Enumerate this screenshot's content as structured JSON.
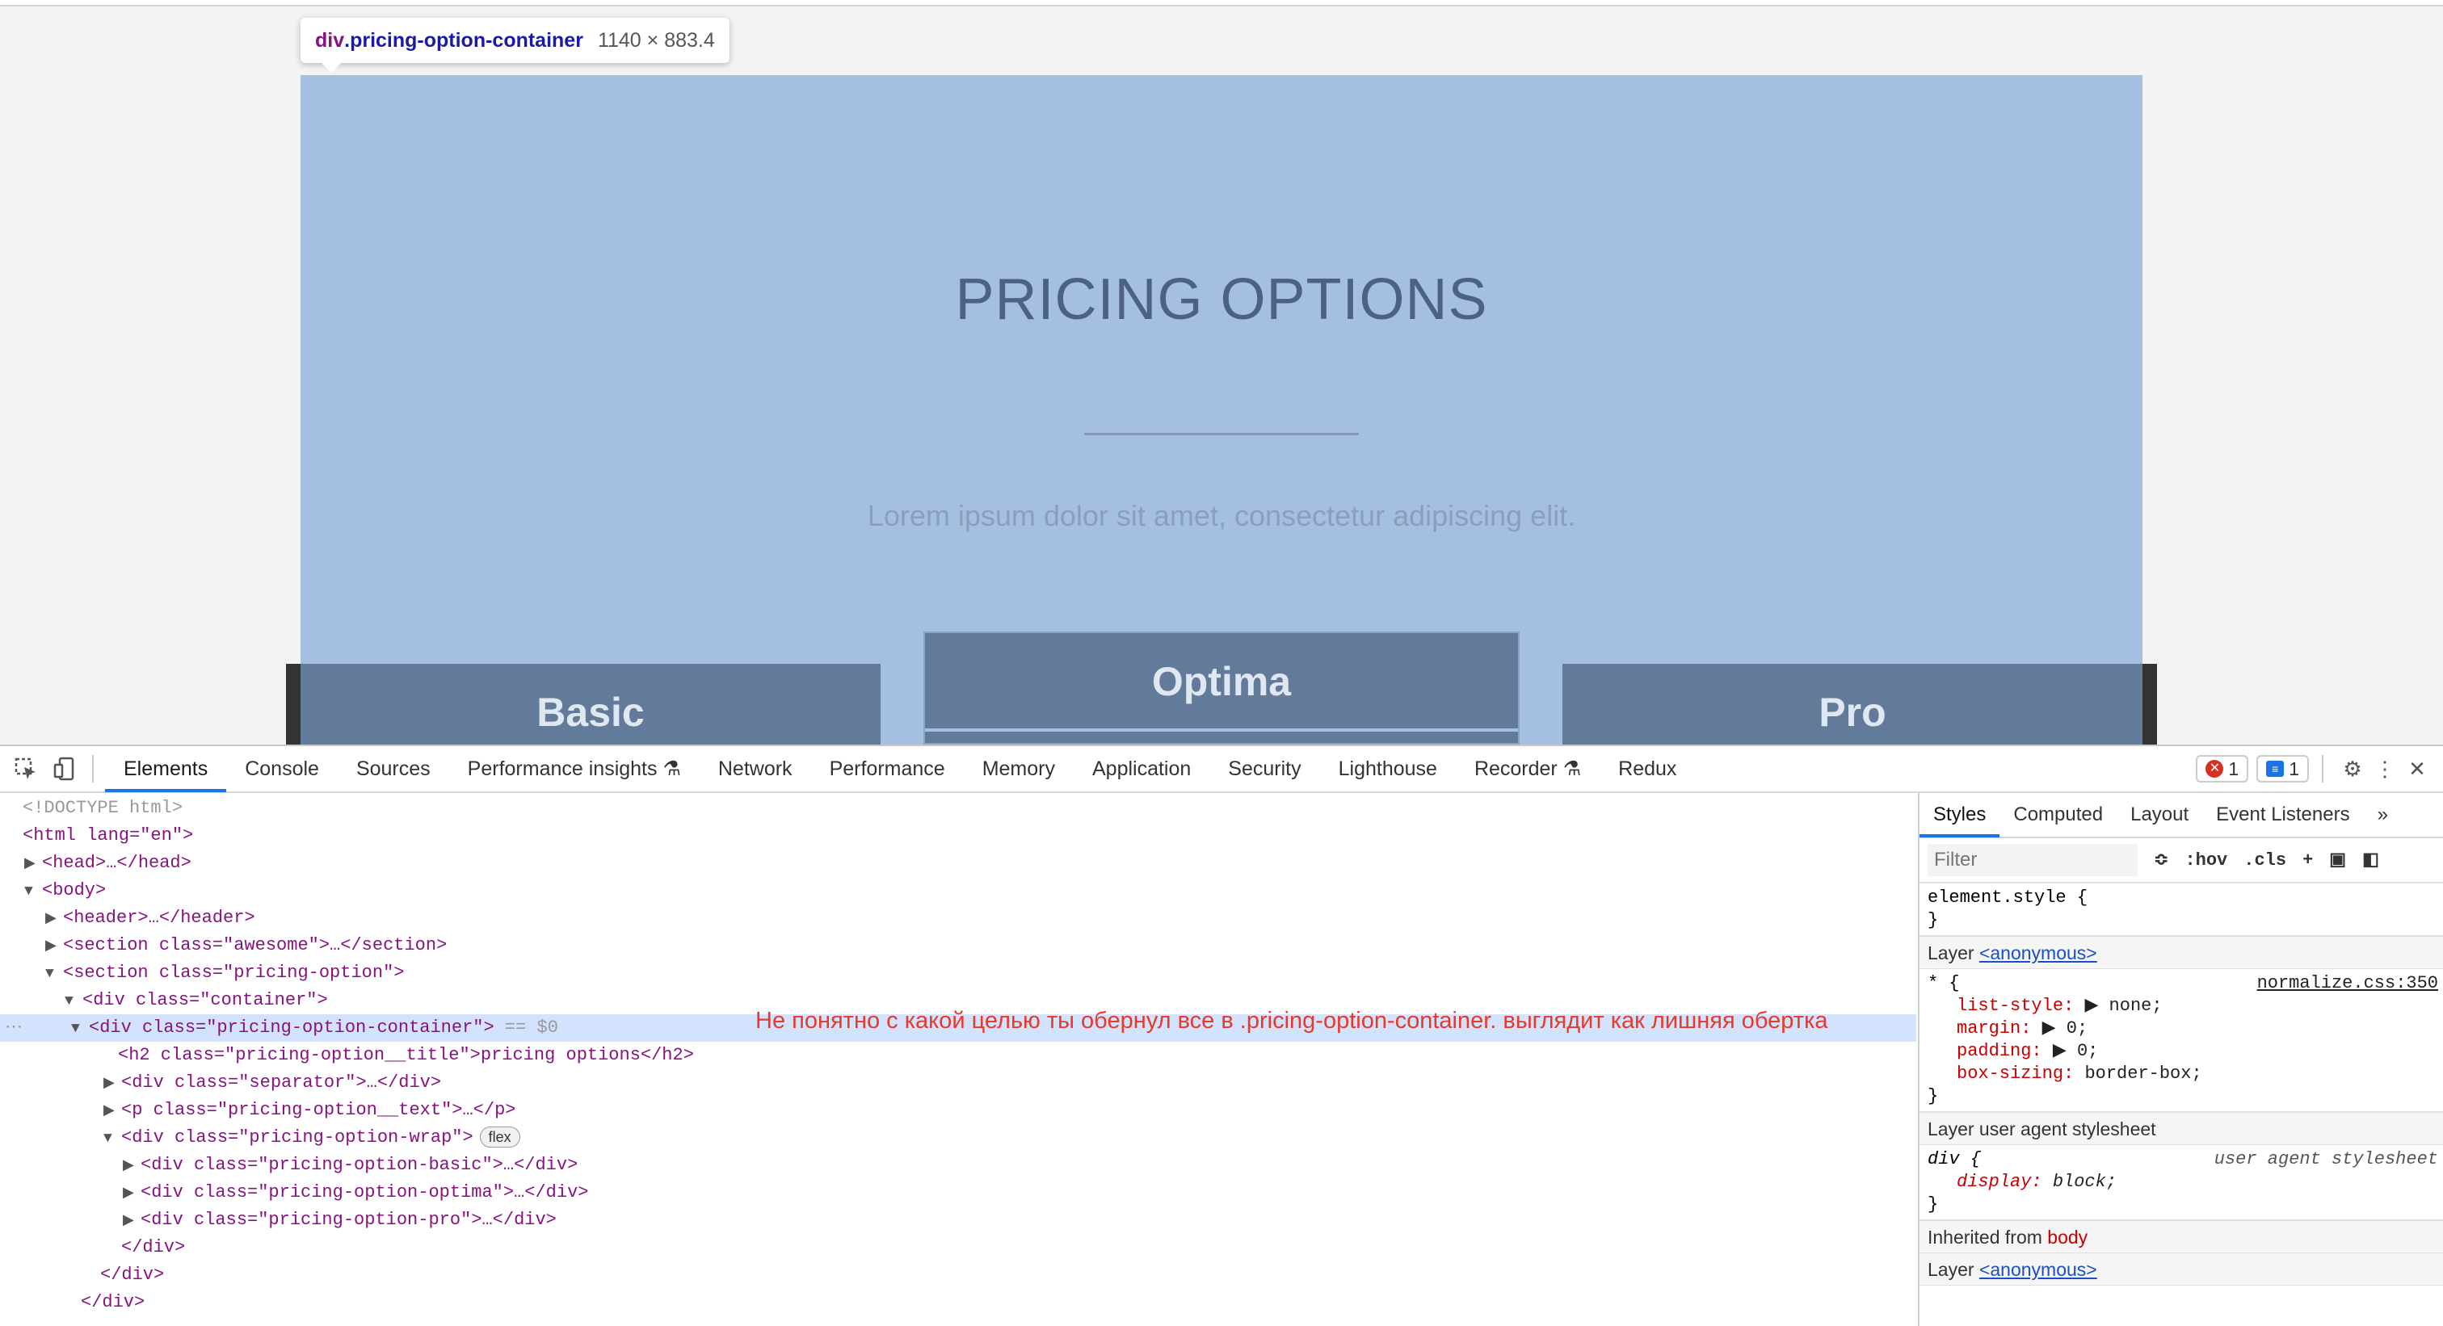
{
  "viewport": {
    "tooltip_tag": "div",
    "tooltip_class": ".pricing-option-container",
    "tooltip_dims": "1140 × 883.4",
    "title": "PRICING OPTIONS",
    "text": "Lorem ipsum dolor sit amet, consectetur adipiscing elit.",
    "cards": {
      "basic": "Basic",
      "optima": "Optima",
      "pro": "Pro"
    },
    "highlight_color": "#a4bfe0"
  },
  "devtools": {
    "tabs": [
      "Elements",
      "Console",
      "Sources",
      "Performance insights",
      "Network",
      "Performance",
      "Memory",
      "Application",
      "Security",
      "Lighthouse",
      "Recorder",
      "Redux"
    ],
    "active_tab": "Elements",
    "error_count": "1",
    "message_count": "1",
    "dom": [
      "<!DOCTYPE html>",
      "<html lang=\"en\">",
      "<head>…</head>",
      "<body>",
      "<header>…</header>",
      "<section class=\"awesome\">…</section>",
      "<section class=\"pricing-option\">",
      "<div class=\"container\">",
      "<div class=\"pricing-option-container\">",
      "<h2 class=\"pricing-option__title\">pricing options</h2>",
      "<div class=\"separator\">…</div>",
      "<p class=\"pricing-option__text\">…</p>",
      "<div class=\"pricing-option-wrap\">",
      "<div class=\"pricing-option-basic\">…</div>",
      "<div class=\"pricing-option-optima\">…</div>",
      "<div class=\"pricing-option-pro\">…</div>",
      "</div>",
      "</div>",
      "</div>"
    ],
    "selected_marker": "== $0",
    "flex_badge": "flex",
    "review_note": "Не понятно с какой целью ты обернул все в .pricing-option-container. выглядит как лишняя обертка",
    "styles": {
      "tabs": [
        "Styles",
        "Computed",
        "Layout",
        "Event Listeners"
      ],
      "filter_placeholder": "Filter",
      "hov": ":hov",
      "cls": ".cls",
      "element_style": "element.style {",
      "layer_label": "Layer",
      "layer_link": "<anonymous>",
      "star_rule_selector": "* {",
      "star_rule_source": "normalize.css:350",
      "star_props": [
        {
          "name": "list-style",
          "value": "▶ none;"
        },
        {
          "name": "margin",
          "value": "▶ 0;"
        },
        {
          "name": "padding",
          "value": "▶ 0;"
        },
        {
          "name": "box-sizing",
          "value": "border-box;"
        }
      ],
      "ua_layer": "Layer user agent stylesheet",
      "div_selector": "div {",
      "ua_source": "user agent stylesheet",
      "div_prop": "display",
      "div_value": "block;",
      "inherited_label": "Inherited from",
      "inherited_from": "body"
    }
  }
}
